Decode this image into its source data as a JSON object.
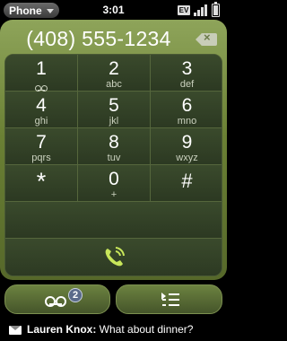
{
  "status": {
    "app_name": "Phone",
    "time": "3:01",
    "network_badge": "EV"
  },
  "dialer": {
    "number": "(408) 555-1234",
    "keys": [
      {
        "digit": "1",
        "letters": "",
        "icon": "voicemail-icon"
      },
      {
        "digit": "2",
        "letters": "abc"
      },
      {
        "digit": "3",
        "letters": "def"
      },
      {
        "digit": "4",
        "letters": "ghi"
      },
      {
        "digit": "5",
        "letters": "jkl"
      },
      {
        "digit": "6",
        "letters": "mno"
      },
      {
        "digit": "7",
        "letters": "pqrs"
      },
      {
        "digit": "8",
        "letters": "tuv"
      },
      {
        "digit": "9",
        "letters": "wxyz"
      },
      {
        "digit": "*",
        "letters": ""
      },
      {
        "digit": "0",
        "letters": "+"
      },
      {
        "digit": "#",
        "letters": ""
      }
    ]
  },
  "voicemail": {
    "badge_count": "2"
  },
  "notification": {
    "sender": "Lauren Knox:",
    "message": " What about dinner?"
  },
  "colors": {
    "accent_green": "#8ea45a",
    "call_icon": "#c8e65a"
  }
}
